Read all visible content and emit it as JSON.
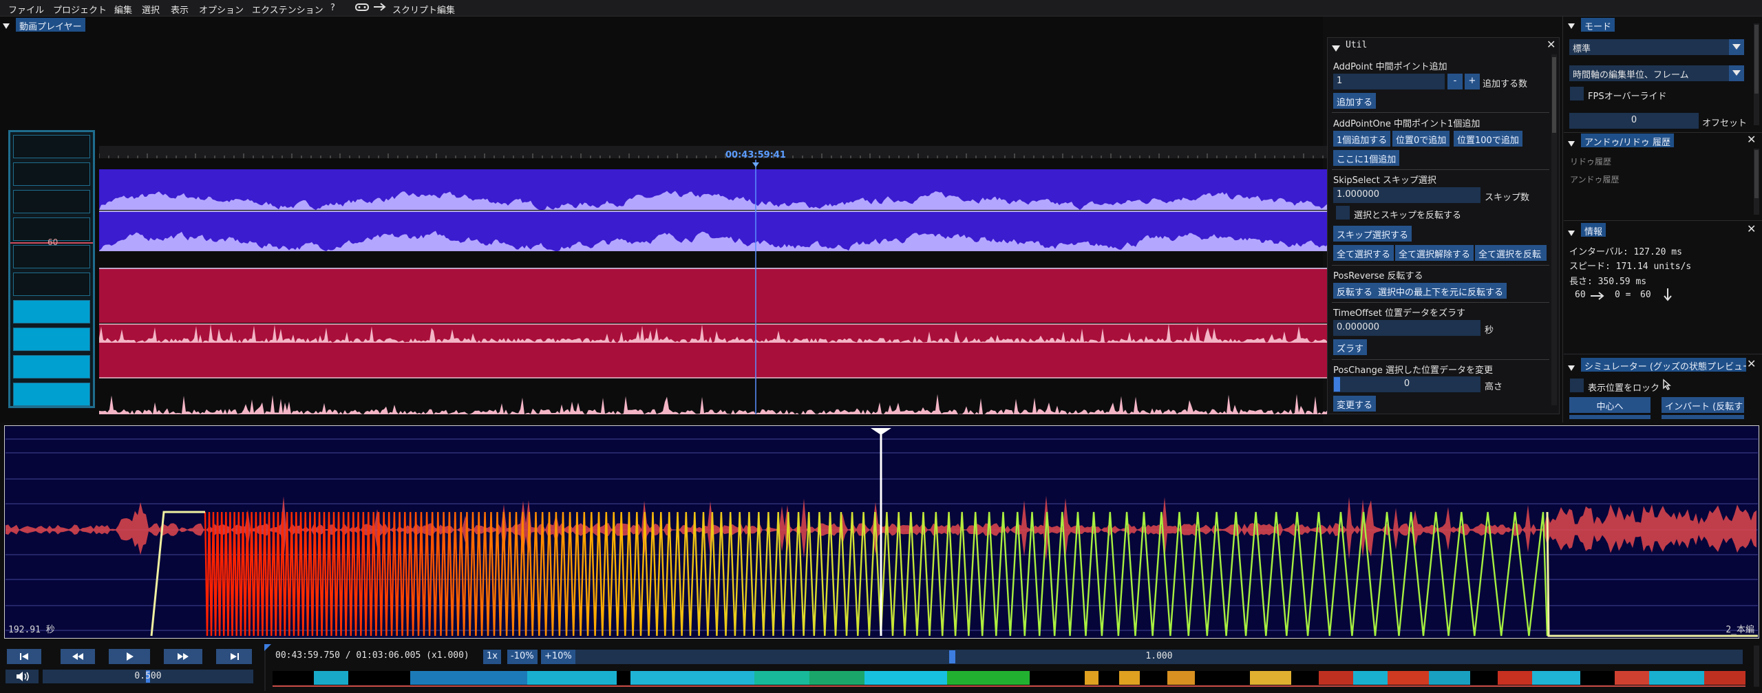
{
  "menu": {
    "file": "ファイル",
    "project": "プロジェクト",
    "edit": "編集",
    "select": "選択",
    "view": "表示",
    "option": "オプション",
    "extension": "エクステンション",
    "help": "?",
    "script_edit": "スクリプト編集"
  },
  "player": {
    "tab": "動画プレイヤー",
    "timecode": "00:43:59:41",
    "gauge_value": "60",
    "gauge_level_fraction": 0.6
  },
  "util": {
    "title": "Util",
    "addpoint": {
      "title": "AddPoint 中間ポイント追加",
      "count_value": "1",
      "minus": "-",
      "plus": "+",
      "count_label": "追加する数",
      "add_button": "追加する"
    },
    "addpointone": {
      "title": "AddPointOne 中間ポイント1個追加",
      "add_one": "1個追加する",
      "add_pos0": "位置0で追加",
      "add_pos100": "位置100で追加",
      "add_here": "ここに1個追加"
    },
    "skipselect": {
      "title": "SkipSelect スキップ選択",
      "skip_value": "1.000000",
      "skip_label": "スキップ数",
      "invert_label": "選択とスキップを反転する",
      "skip_button": "スキップ選択する",
      "select_all": "全て選択する",
      "deselect_all": "全て選択解除する",
      "invert_all": "全て選択を反転"
    },
    "posreverse": {
      "title": "PosReverse 反転する",
      "reverse": "反転する",
      "reverse_updown": "選択中の最上下を元に反転する"
    },
    "timeoffset": {
      "title": "TimeOffset 位置データをズラす",
      "value": "0.000000",
      "unit": "秒",
      "shift": "ズラす"
    },
    "poschange": {
      "title": "PosChange 選択した位置データを変更",
      "value": "0",
      "height_label": "高さ",
      "change": "変更する"
    }
  },
  "mode": {
    "tab": "モード",
    "select1": "標準",
    "select2": "時間軸の編集単位、フレーム",
    "fps_override": "FPSオーバーライド",
    "offset_value": "0",
    "offset_label": "オフセット"
  },
  "undo": {
    "tab": "アンドゥ/リドゥ 履歴",
    "redo_history": "リドゥ履歴",
    "undo_history": "アンドゥ履歴"
  },
  "info": {
    "tab": "情報",
    "interval": "インターバル: 127.20 ms",
    "speed": "スピード: 171.14 units/s",
    "length": "長さ: 350.59 ms",
    "from": "60",
    "mid": "0 =",
    "to": "60"
  },
  "simulator": {
    "tab": "シミュレーター (グッズの状態プレビュー",
    "lock_label": "表示位置をロック",
    "center": "中心へ",
    "invert": "インバート (反転する"
  },
  "timeline": {
    "left_label": "192.91 秒",
    "right_label": "2_本編"
  },
  "controls": {
    "time": "00:43:59.750 / 01:03:06.005 (x1.000)",
    "speed_1x": "1x",
    "speed_minus": "-10%",
    "speed_plus": "+10%",
    "speed_value": "1.000",
    "volume": "0.500",
    "volume_fraction": 0.5,
    "speed_slider_fraction": 0.32
  },
  "colors": {
    "accent": "#26528a",
    "audio_track_1": "#3b1ccf",
    "audio_track_2": "#a80f3a",
    "timeline_bg": "#05053a",
    "wave_red": "#ff2000",
    "wave_green": "#a5f040"
  }
}
